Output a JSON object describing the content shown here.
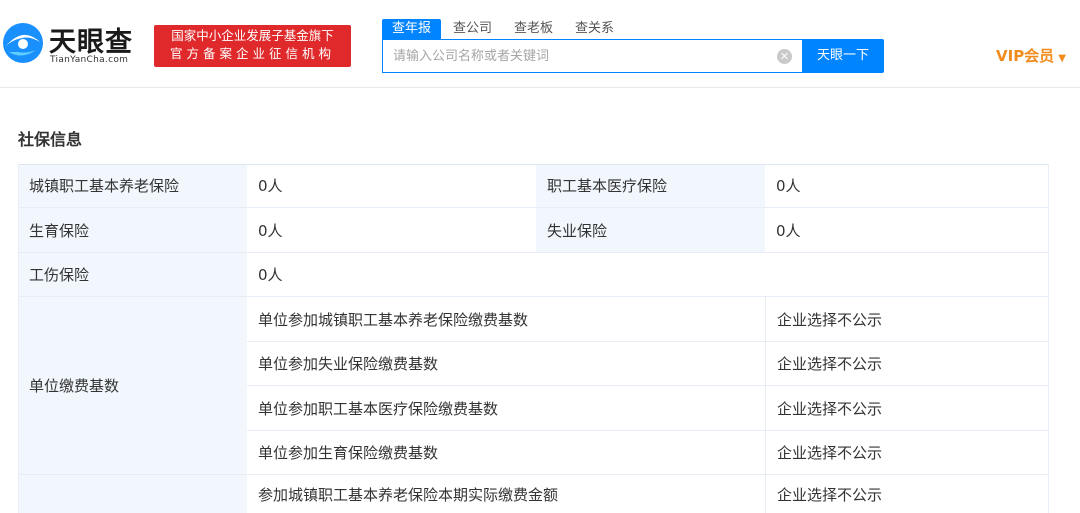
{
  "header": {
    "logo": {
      "title": "天眼查",
      "subtitle": "TianYanCha.com"
    },
    "badge": {
      "line1": "国家中小企业发展子基金旗下",
      "line2": "官方备案企业征信机构"
    },
    "tabs": [
      {
        "label": "查年报",
        "active": true
      },
      {
        "label": "查公司",
        "active": false
      },
      {
        "label": "查老板",
        "active": false
      },
      {
        "label": "查关系",
        "active": false
      }
    ],
    "search": {
      "placeholder": "请输入公司名称或者关键词",
      "value": "",
      "button_label": "天眼一下"
    },
    "vip_label": "VIP会员"
  },
  "section": {
    "title": "社保信息"
  },
  "table": {
    "rows": [
      {
        "label": "城镇职工基本养老保险",
        "value": "0人",
        "label2": "职工基本医疗保险",
        "value2": "0人"
      },
      {
        "label": "生育保险",
        "value": "0人",
        "label2": "失业保险",
        "value2": "0人"
      },
      {
        "label": "工伤保险",
        "value": "0人"
      }
    ],
    "group": {
      "label": "单位缴费基数",
      "items": [
        {
          "name": "单位参加城镇职工基本养老保险缴费基数",
          "value": "企业选择不公示"
        },
        {
          "name": "单位参加失业保险缴费基数",
          "value": "企业选择不公示"
        },
        {
          "name": "单位参加职工基本医疗保险缴费基数",
          "value": "企业选择不公示"
        },
        {
          "name": "单位参加生育保险缴费基数",
          "value": "企业选择不公示"
        }
      ]
    },
    "next_group_items": [
      {
        "name": "参加城镇职工基本养老保险本期实际缴费金额",
        "value": "企业选择不公示"
      }
    ]
  },
  "colors": {
    "brand_blue": "#0084ff",
    "badge_red": "#e0292b",
    "vip_orange": "#f08b1c",
    "label_bg": "#f2f7fd"
  }
}
